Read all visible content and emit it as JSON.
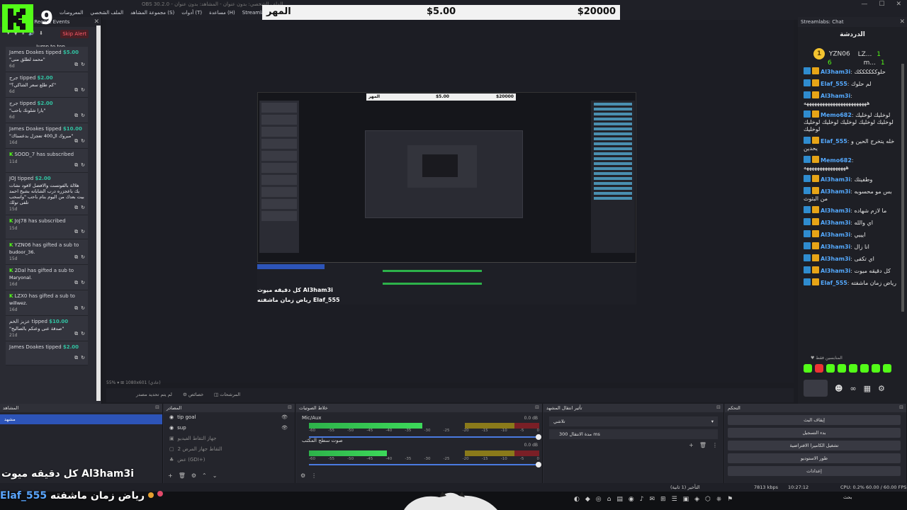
{
  "window": {
    "title_text": "OBS 30.2.0 - الملف الشخصي: بدون عنوان - المشاهد: بدون عنوان",
    "menu": [
      "Streamlabs",
      "مساعدة (H)",
      "أدوات (T)",
      "مجموعة المشاهد (S)",
      "الملف الشخصي",
      "المعروضات"
    ],
    "controls": [
      "—",
      "☐",
      "✕"
    ]
  },
  "logo": {
    "letter": "K",
    "number": "9"
  },
  "banner": {
    "left_text": "المهر",
    "mid_text": "$5.00",
    "right_text": "$20000"
  },
  "left_dock": {
    "title": "Streamlabs: Recent Events",
    "close": "✕",
    "tools": [
      "▾",
      "▼",
      "⏸",
      "🔊",
      "⬇"
    ],
    "skip_alert": "Skip Alert",
    "jump_to_top": "Jump to top",
    "events": [
      {
        "user": "James Doakes",
        "action": "tipped",
        "amount": "$5.00",
        "message": "\"محمد لطلق منى\"",
        "time": "6d"
      },
      {
        "user": "جرج",
        "action": "tipped",
        "amount": "$2.00",
        "message": "\"كم طلع سعر الشاكي؟\"",
        "time": "6d"
      },
      {
        "user": "جرج",
        "action": "tipped",
        "amount": "$2.00",
        "message": "\"يارا شلونك ياحب\"",
        "time": "6d"
      },
      {
        "user": "James Doakes",
        "action": "tipped",
        "amount": "$10.00",
        "message": "\"مبروك ال400 تعجزل بدعسناك\"",
        "time": "16d"
      },
      {
        "user": "SOOD_7",
        "action": "has subscribed",
        "amount": "",
        "message": "",
        "time": "11d"
      },
      {
        "user": "JOJ",
        "action": "tipped",
        "amount": "$2.00",
        "message": "هلالة بالفوتست والافضل لافود نشات يك باعجزره درب الشابانه بشيخ احمد بيت بعدك من اليوم بنام باحب \"واسحب تلفى تولك",
        "time": "15d"
      },
      {
        "user": "JoJ78",
        "action": "has subscribed",
        "amount": "",
        "message": "",
        "time": "15d"
      },
      {
        "user": "YZN06",
        "action": "has gifted a sub to",
        "amount": "",
        "message": "budoor_36.",
        "time": "15d"
      },
      {
        "user": "2Dal",
        "action": "has gifted a sub to",
        "amount": "",
        "message": "Maryonal.",
        "time": "16d"
      },
      {
        "user": "LZX0",
        "action": "has gifted a sub to",
        "amount": "",
        "message": "willwez.",
        "time": "16d"
      },
      {
        "user": "عزيز الخم",
        "action": "tipped",
        "amount": "$10.00",
        "message": "\"صدقة عنى وعنكم بالصاليح\"",
        "time": "21d"
      },
      {
        "user": "James Doakes",
        "action": "tipped",
        "amount": "$2.00",
        "message": "",
        "time": ""
      }
    ]
  },
  "nested": {
    "banner_left": "المهر",
    "banner_mid": "$5.00",
    "banner_right": "$20000",
    "caption1": "كل دقيقه ميوت Al3ham3i",
    "caption2": "رياض زمان ماشفته Elaf_555"
  },
  "preview_status": "55%   ▾   ⊞  1080x601 (عادي)",
  "midbar": {
    "a": "لم يتم تحديد مصدر",
    "b": "⚙ خصائص",
    "c": "◫ المرشحات"
  },
  "chat": {
    "title": "Streamlabs: Chat",
    "close": "✕",
    "header": "الدردشة",
    "top_user": "YZN06",
    "top_num": "6",
    "lb2_user": "LZ...",
    "lb2_num": "1",
    "lb3_user": "m...",
    "lb3_num": "1",
    "messages": [
      {
        "user": "Al3ham3i",
        "text": "حلوككككككك",
        "color": "#55aaff"
      },
      {
        "user": "Elaf_555",
        "text": "لم حلوك",
        "color": "#55aaff"
      },
      {
        "user": "Al3ham3i",
        "text": "ههههههههههههههههههههههههه",
        "color": "#55aaff"
      },
      {
        "user": "Memo682",
        "text": "لوخليك لوخليك لوخليك لوخليك لوخليك لوخليك لوخليك لوخليك",
        "color": "#55aaff"
      },
      {
        "user": "Elaf_555",
        "text": "خله يتخرج الحين و يحدين",
        "color": "#55aaff"
      },
      {
        "user": "Memo682",
        "text": "ههههههههههههههههه",
        "color": "#55aaff"
      },
      {
        "user": "Al3ham3i",
        "text": "وطفيتك",
        "color": "#55aaff"
      },
      {
        "user": "Al3ham3i",
        "text": "بس مو محسوبه من البثوث",
        "color": "#55aaff"
      },
      {
        "user": "Al3ham3i",
        "text": "ما لازم شهاده",
        "color": "#55aaff"
      },
      {
        "user": "Al3ham3i",
        "text": "اي والله",
        "color": "#55aaff"
      },
      {
        "user": "Al3ham3i",
        "text": "ايييي",
        "color": "#55aaff"
      },
      {
        "user": "Al3ham3i",
        "text": "انا زال",
        "color": "#55aaff"
      },
      {
        "user": "Al3ham3i",
        "text": "اي تكفى",
        "color": "#55aaff"
      },
      {
        "user": "Al3ham3i",
        "text": "كل دقيقه ميوت",
        "color": "#55aaff"
      },
      {
        "user": "Elaf_555",
        "text": "رياض زمان ماشفته",
        "color": "#55aaff"
      }
    ],
    "emote_label": "♥ المنابسين فقط",
    "bottom_icons": [
      "☻",
      "∞",
      "▦",
      "⚙"
    ]
  },
  "docks": {
    "scenes": {
      "title": "المشاهد",
      "row": "مشهد"
    },
    "sources": {
      "title": "المصادر",
      "rows": [
        {
          "label": "tip goal",
          "dim": false
        },
        {
          "label": "sup",
          "dim": false
        },
        {
          "label": "جهاز التقاط الفيديو",
          "dim": true
        },
        {
          "label": "التقاط جهاز المرض 2",
          "dim": true
        },
        {
          "label": "عض (GDI+)",
          "dim": true
        }
      ]
    },
    "mixer": {
      "title": "خلاط الصوتيات",
      "ch1": "Mic/Aux",
      "ch1_db": "0.0 dB",
      "ch2": "صوت سطح المكتب",
      "ch2_db": "0.0 dB",
      "scale": [
        "-60",
        "-55",
        "-50",
        "-45",
        "-40",
        "-35",
        "-30",
        "-25",
        "-20",
        "-15",
        "-10",
        "-5",
        "0"
      ]
    },
    "transitions": {
      "title": "تأثير انتقال المشهد",
      "select": "تلاشي",
      "duration_label": "مدة الانتقال",
      "duration": "300 ms"
    },
    "controls": {
      "title": "التحكم",
      "buttons": [
        "إيقاف البث",
        "بدء التسجيل",
        "تشغيل الكاميرا الافتراضية",
        "طور الاستوديو",
        "إعدادات"
      ]
    }
  },
  "captions": {
    "line1": "كل دقيقه ميوت Al3ham3i",
    "line2_user": "Elaf_555",
    "line2_text": "رياض زمان ماشفته"
  },
  "statusbar": {
    "delay": "التأخير (1 ثانية)",
    "frames": "إسقاط الإطارات: 0 (0.0 %)",
    "bitrate": "7813 kbps",
    "time": "10:27:12",
    "rec": "00:00:00",
    "cpu": "CPU: 0.2%",
    "fps": "60.00 / 60.00 FPS"
  },
  "taskbar": {
    "icons": [
      "◐",
      "◆",
      "◎",
      "⌂",
      "▤",
      "◉",
      "♪",
      "✉",
      "⊞",
      "☰",
      "▣",
      "◈",
      "⬡",
      "⎈",
      "⚑"
    ],
    "clock_time": "AR",
    "search": "بحث"
  },
  "colors": {
    "accent": "#2d54b8",
    "kick_green": "#53fc18",
    "tip_green": "#31c3a2",
    "user_blue": "#55aaff"
  }
}
